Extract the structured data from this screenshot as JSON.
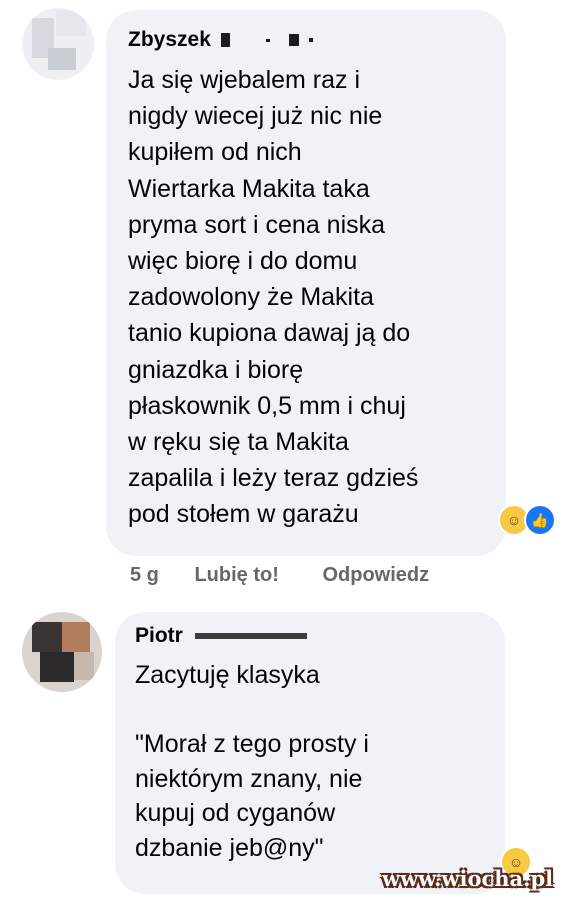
{
  "comments": [
    {
      "author": "Zbyszek",
      "text": "Ja się wjebalem raz i\nnigdy wiecej już nic nie\nkupiłem od nich\nWiertarka Makita taka\npryma sort i cena niska\nwięc biorę i do domu\nzadowolony że Makita\ntanio kupiona dawaj ją do\ngniazdka i biorę\npłaskownik 0,5 mm i chuj\nw ręku się ta Makita\nzapalila i leży teraz gdzieś\npod stołem w garażu",
      "reactions": [
        "haha-icon",
        "like-icon"
      ],
      "actions": {
        "time": "5 g",
        "like": "Lubię to!",
        "reply": "Odpowiedz"
      }
    },
    {
      "author": "Piotr",
      "text": "Zacytuję klasyka\n\n\"Morał z tego prosty i\nniektórym znany, nie\nkupuj od cyganów\ndzbanie jeb@ny\"",
      "reactions": [
        "haha-icon"
      ]
    }
  ],
  "watermark": "www.wiocha.pl",
  "colors": {
    "bubble": "#f0f2f5",
    "meta_text": "#65676b",
    "like_blue": "#1877f2",
    "haha_yellow": "#f7c944"
  }
}
